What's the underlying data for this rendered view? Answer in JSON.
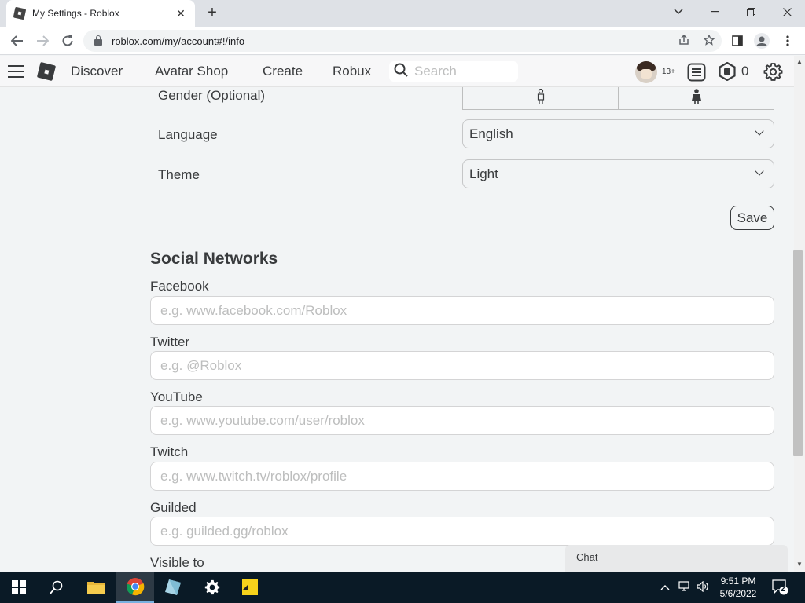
{
  "browser": {
    "tab_title": "My Settings - Roblox",
    "url": "roblox.com/my/account#!/info",
    "tab_close": "✕",
    "new_tab": "+"
  },
  "nav": {
    "links": [
      "Discover",
      "Avatar Shop",
      "Create",
      "Robux"
    ],
    "search_placeholder": "Search",
    "age_badge": "13+",
    "robux_count": "0"
  },
  "settings": {
    "gender_label": "Gender (Optional)",
    "language_label": "Language",
    "language_value": "English",
    "theme_label": "Theme",
    "theme_value": "Light",
    "save_label": "Save"
  },
  "social": {
    "title": "Social Networks",
    "fields": [
      {
        "label": "Facebook",
        "placeholder": "e.g. www.facebook.com/Roblox"
      },
      {
        "label": "Twitter",
        "placeholder": "e.g. @Roblox"
      },
      {
        "label": "YouTube",
        "placeholder": "e.g. www.youtube.com/user/roblox"
      },
      {
        "label": "Twitch",
        "placeholder": "e.g. www.twitch.tv/roblox/profile"
      },
      {
        "label": "Guilded",
        "placeholder": "e.g. guilded.gg/roblox"
      }
    ],
    "visible_to_label": "Visible to"
  },
  "chat": {
    "label": "Chat"
  },
  "taskbar": {
    "time": "9:51 PM",
    "date": "5/6/2022",
    "notification_count": "2"
  }
}
